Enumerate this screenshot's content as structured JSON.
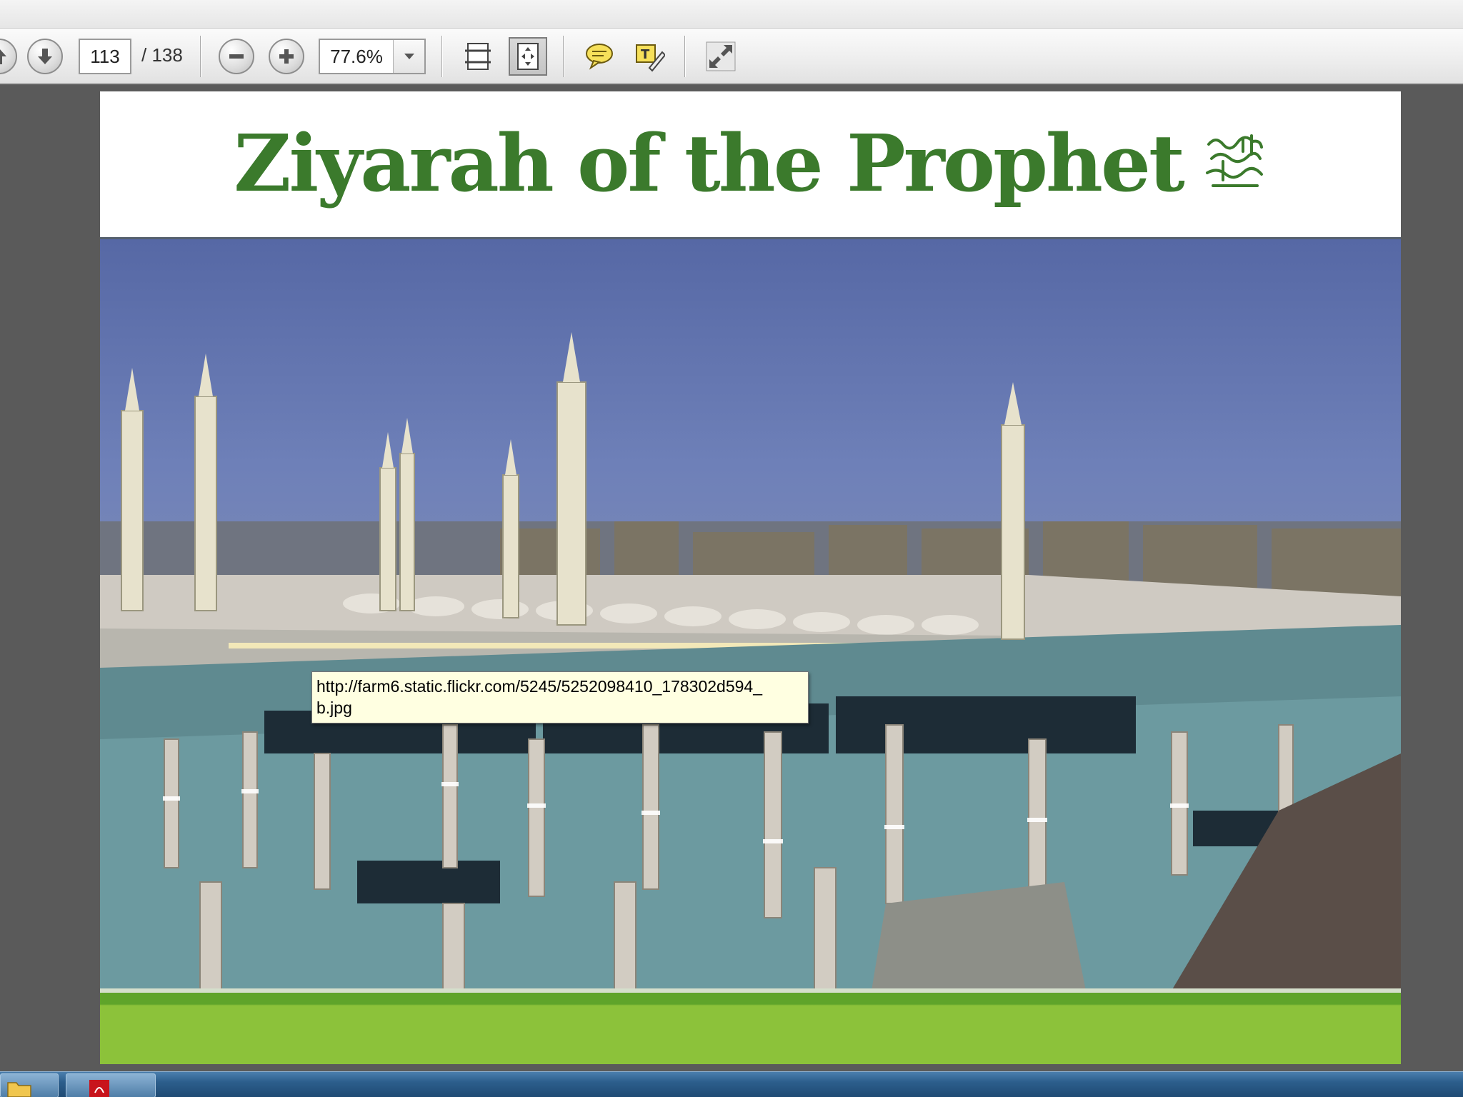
{
  "toolbar": {
    "page_current": "113",
    "page_total": "/ 138",
    "zoom_value": "77.6%",
    "icons": [
      "arrow-up-icon",
      "arrow-down-icon",
      "zoom-out-icon",
      "zoom-in-icon",
      "fit-width-icon",
      "fit-page-icon",
      "comment-icon",
      "sign-icon",
      "fullscreen-icon"
    ]
  },
  "document": {
    "title": "Ziyarah of the Prophet",
    "seal_description": "Arabic calligraphy salutation",
    "accent_color": "#3b7a2c",
    "footer_color": "#8cc23a"
  },
  "tooltip": {
    "line1": "http://farm6.static.flickr.com/5245/5252098410_178302d594_",
    "line2": "b.jpg"
  },
  "taskbar": {
    "apps": [
      "folder-icon",
      "acrobat-icon"
    ]
  }
}
